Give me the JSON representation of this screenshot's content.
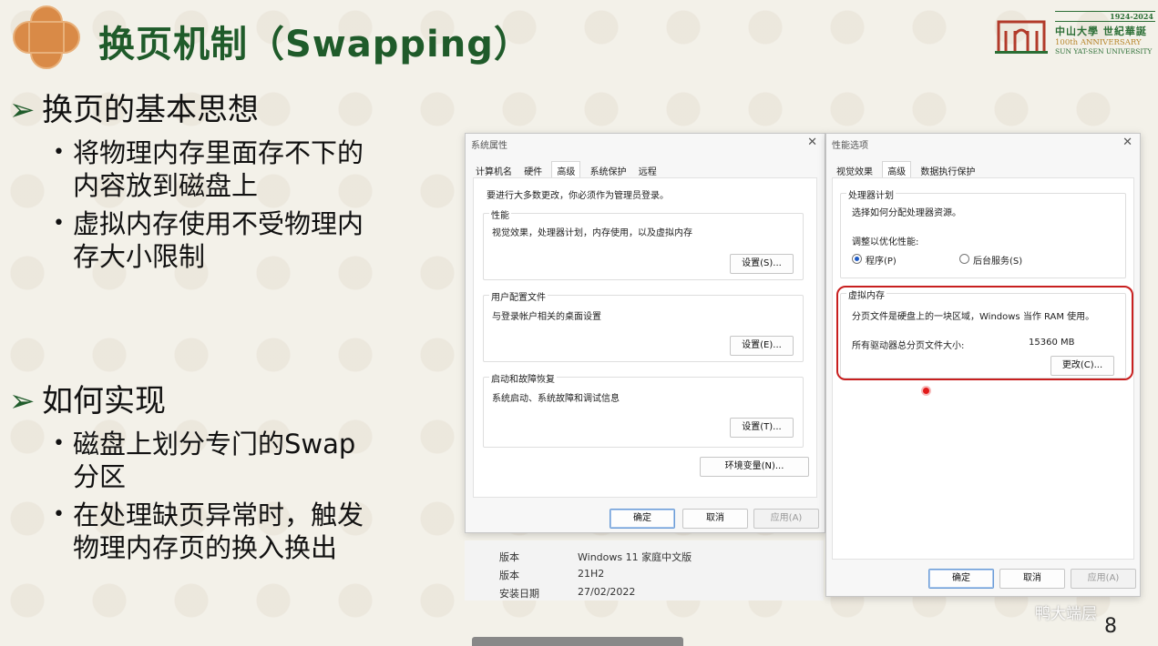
{
  "slide": {
    "title": "换页机制（Swapping）",
    "page_number": "8",
    "watermark": "鸭大端层"
  },
  "university": {
    "years": "1924-2024",
    "name_cn": "中山大學 世紀華誕",
    "anniversary_en": "100th ANNIVERSARY",
    "name_en": "SUN YAT-SEN UNIVERSITY"
  },
  "bullets": {
    "section1": {
      "heading": "换页的基本思想",
      "items": [
        "将物理内存里面存不下的内容放到磁盘上",
        "虚拟内存使用不受物理内存大小限制"
      ],
      "lines": [
        [
          "将物理内存里面存不下的",
          "内容放到磁盘上"
        ],
        [
          "虚拟内存使用不受物理内",
          "存大小限制"
        ]
      ]
    },
    "section2": {
      "heading": "如何实现",
      "lines": [
        [
          "磁盘上划分专门的Swap",
          "分区"
        ],
        [
          "在处理缺页异常时，触发",
          "物理内存页的换入换出"
        ]
      ]
    }
  },
  "sysprops": {
    "title": "系统属性",
    "tabs": [
      "计算机名",
      "硬件",
      "高级",
      "系统保护",
      "远程"
    ],
    "notice": "要进行大多数更改，你必须作为管理员登录。",
    "groups": [
      {
        "label": "性能",
        "desc": "视觉效果，处理器计划，内存使用，以及虚拟内存",
        "button": "设置(S)..."
      },
      {
        "label": "用户配置文件",
        "desc": "与登录帐户相关的桌面设置",
        "button": "设置(E)..."
      },
      {
        "label": "启动和故障恢复",
        "desc": "系统启动、系统故障和调试信息",
        "button": "设置(T)..."
      }
    ],
    "env_button": "环境变量(N)...",
    "ok": "确定",
    "cancel": "取消",
    "apply": "应用(A)"
  },
  "perf": {
    "title": "性能选项",
    "tabs": [
      "视觉效果",
      "高级",
      "数据执行保护"
    ],
    "cpu_label": "处理器计划",
    "cpu_desc": "选择如何分配处理器资源。",
    "adjust_label": "调整以优化性能:",
    "radio_programs": "程序(P)",
    "radio_services": "后台服务(S)",
    "vm_label": "虚拟内存",
    "vm_desc": "分页文件是硬盘上的一块区域，Windows 当作 RAM 使用。",
    "vm_total_label": "所有驱动器总分页文件大小:",
    "vm_total_value": "15360 MB",
    "change_button": "更改(C)...",
    "ok": "确定",
    "cancel": "取消",
    "apply": "应用(A)"
  },
  "sysinfo": {
    "rows": [
      {
        "key": "版本",
        "value": "Windows 11 家庭中文版"
      },
      {
        "key": "版本",
        "value": "21H2"
      },
      {
        "key": "安装日期",
        "value": "27/02/2022"
      }
    ]
  },
  "colors": {
    "title_green": "#1f5b2a",
    "highlight_red": "#c81f1f",
    "badge_orange": "#d98a47"
  },
  "icons": {
    "bullet_arrow": "triangle-arrow-icon",
    "close": "close-icon"
  }
}
